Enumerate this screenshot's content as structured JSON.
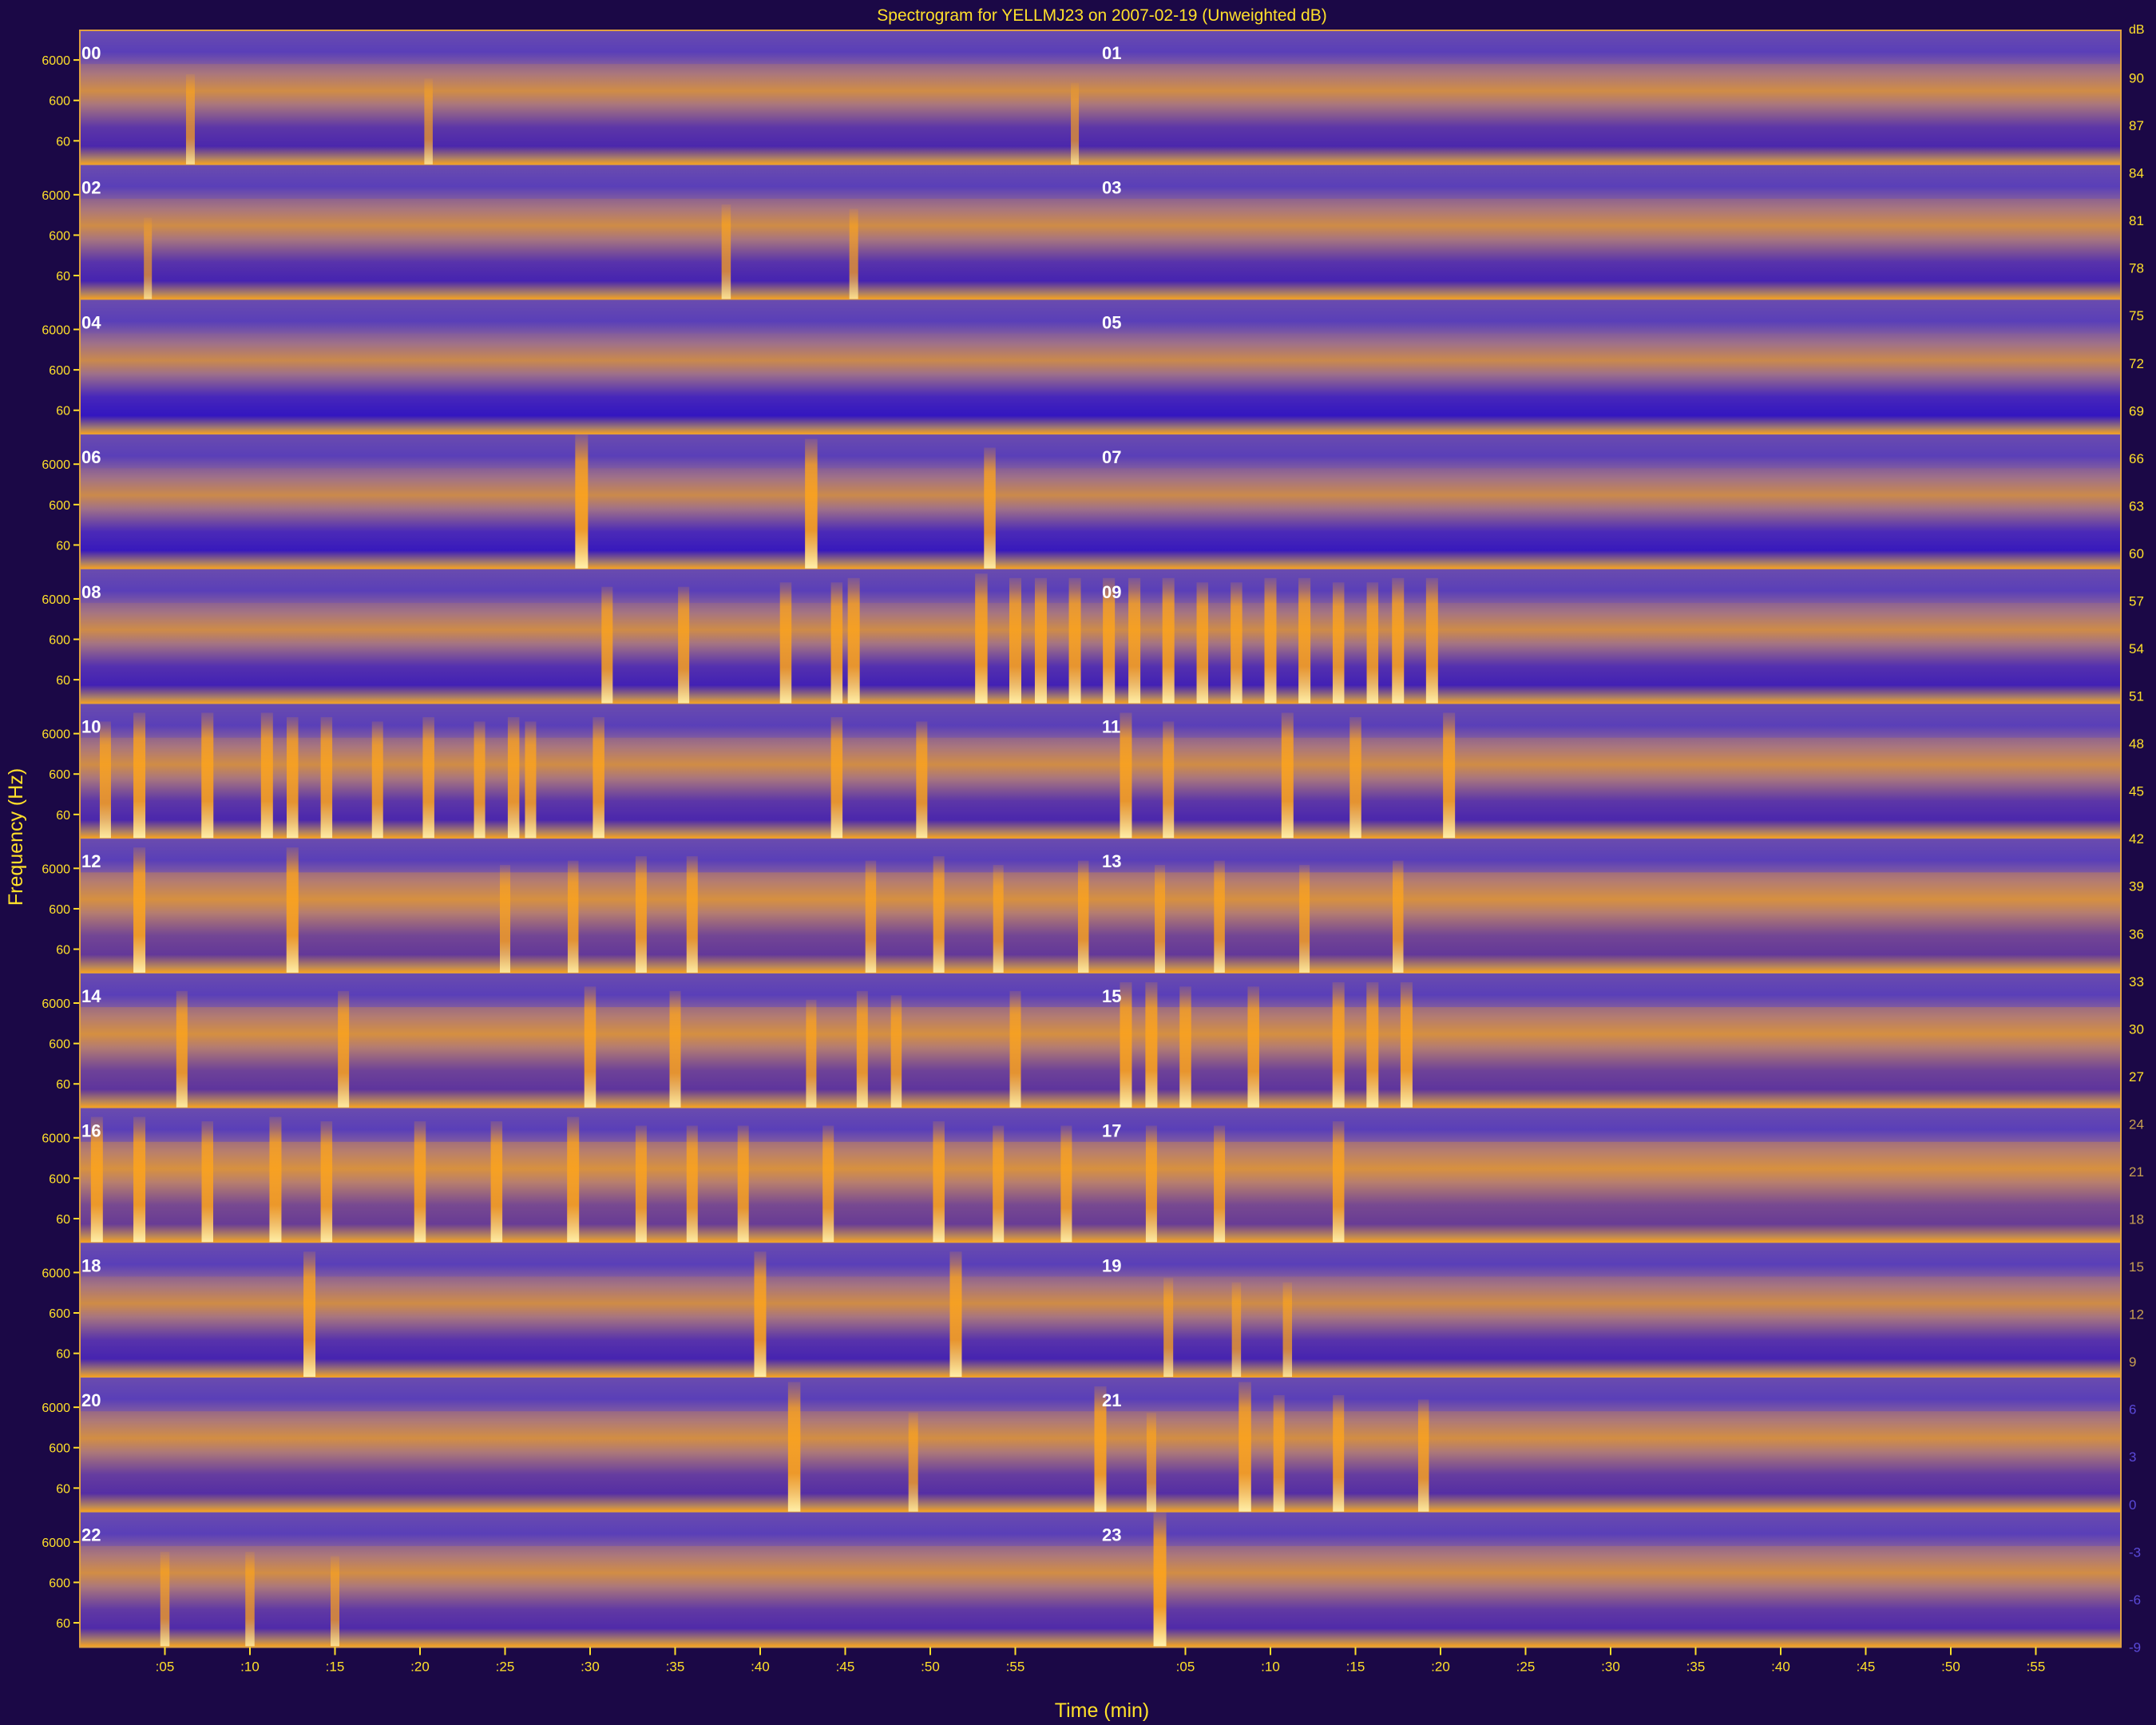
{
  "chart_data": {
    "type": "heatmap",
    "title": "Spectrogram for YELLMJ23 on 2007-02-19 (Unweighted dB)",
    "xlabel": "Time (min)",
    "ylabel": "Frequency (Hz)",
    "hour_labels": [
      "00",
      "01",
      "02",
      "03",
      "04",
      "05",
      "06",
      "07",
      "08",
      "09",
      "10",
      "11",
      "12",
      "13",
      "14",
      "15",
      "16",
      "17",
      "18",
      "19",
      "20",
      "21",
      "22",
      "23"
    ],
    "freq_ticks": [
      "6000",
      "600",
      "60"
    ],
    "minute_ticks": [
      ":05",
      ":10",
      ":15",
      ":20",
      ":25",
      ":30",
      ":35",
      ":40",
      ":45",
      ":50",
      ":55"
    ],
    "colorbar_unit": "dB",
    "colorbar_ticks": [
      "90",
      "87",
      "84",
      "81",
      "78",
      "75",
      "72",
      "69",
      "66",
      "63",
      "60",
      "57",
      "54",
      "51",
      "48",
      "45",
      "42",
      "39",
      "36",
      "33",
      "30",
      "27",
      "24",
      "21",
      "18",
      "15",
      "12",
      "9",
      "6",
      "3",
      "0",
      "-3",
      "-6",
      "-9"
    ],
    "colorbar_range": [
      -9,
      93
    ],
    "colormap": {
      "low": "#2a10c8",
      "mid": "#6a4cae",
      "high": "#ffa51a",
      "peak": "#fff2b0"
    },
    "rows": [
      {
        "hour_left": "00",
        "hour_right": "01",
        "activity": 0.35,
        "events": [
          [
            6.5,
            0.5
          ],
          [
            20.5,
            0.45
          ],
          [
            58.5,
            0.4
          ]
        ]
      },
      {
        "hour_left": "02",
        "hour_right": "03",
        "activity": 0.3,
        "events": [
          [
            38,
            0.55
          ],
          [
            45.5,
            0.5
          ],
          [
            4,
            0.4
          ]
        ]
      },
      {
        "hour_left": "04",
        "hour_right": "05",
        "activity": 0.1,
        "events": []
      },
      {
        "hour_left": "06",
        "hour_right": "07",
        "activity": 0.15,
        "events": [
          [
            29.5,
            1.0
          ],
          [
            43,
            0.95
          ],
          [
            53.5,
            0.85
          ]
        ]
      },
      {
        "hour_left": "08",
        "hour_right": "09",
        "activity": 0.25,
        "events": [
          [
            31,
            0.8
          ],
          [
            35.5,
            0.8
          ],
          [
            41.5,
            0.85
          ],
          [
            44.5,
            0.85
          ],
          [
            45.5,
            0.9
          ],
          [
            53,
            0.95
          ],
          [
            55,
            0.9
          ],
          [
            56.5,
            0.9
          ],
          [
            58.5,
            0.9
          ],
          [
            60.5,
            0.9
          ],
          [
            62,
            0.9
          ],
          [
            64,
            0.9
          ],
          [
            66,
            0.85
          ],
          [
            68,
            0.85
          ],
          [
            70,
            0.9
          ],
          [
            72,
            0.9
          ],
          [
            74,
            0.85
          ],
          [
            76,
            0.85
          ],
          [
            77.5,
            0.9
          ],
          [
            79.5,
            0.9
          ]
        ]
      },
      {
        "hour_left": "10",
        "hour_right": "11",
        "activity": 0.35,
        "events": [
          [
            1.5,
            0.8
          ],
          [
            3.5,
            0.9
          ],
          [
            7.5,
            0.9
          ],
          [
            11,
            0.9
          ],
          [
            12.5,
            0.85
          ],
          [
            14.5,
            0.85
          ],
          [
            17.5,
            0.8
          ],
          [
            20.5,
            0.85
          ],
          [
            23.5,
            0.8
          ],
          [
            25.5,
            0.85
          ],
          [
            26.5,
            0.8
          ],
          [
            30.5,
            0.85
          ],
          [
            44.5,
            0.85
          ],
          [
            49.5,
            0.8
          ],
          [
            61.5,
            0.9
          ],
          [
            64,
            0.8
          ],
          [
            71,
            0.9
          ],
          [
            75,
            0.85
          ],
          [
            80.5,
            0.9
          ]
        ]
      },
      {
        "hour_left": "12",
        "hour_right": "13",
        "activity": 0.6,
        "events": [
          [
            3.5,
            0.9
          ],
          [
            12.5,
            0.9
          ],
          [
            25,
            0.7
          ],
          [
            29,
            0.75
          ],
          [
            33,
            0.8
          ],
          [
            36,
            0.8
          ],
          [
            46.5,
            0.75
          ],
          [
            50.5,
            0.8
          ],
          [
            54,
            0.7
          ],
          [
            59,
            0.75
          ],
          [
            63.5,
            0.7
          ],
          [
            67,
            0.75
          ],
          [
            72,
            0.7
          ],
          [
            77.5,
            0.75
          ]
        ]
      },
      {
        "hour_left": "14",
        "hour_right": "15",
        "activity": 0.55,
        "events": [
          [
            6,
            0.8
          ],
          [
            15.5,
            0.8
          ],
          [
            30,
            0.85
          ],
          [
            35,
            0.8
          ],
          [
            43,
            0.7
          ],
          [
            46,
            0.8
          ],
          [
            48,
            0.75
          ],
          [
            55,
            0.8
          ],
          [
            61.5,
            0.9
          ],
          [
            63,
            0.9
          ],
          [
            65,
            0.85
          ],
          [
            69,
            0.85
          ],
          [
            74,
            0.9
          ],
          [
            76,
            0.9
          ],
          [
            78,
            0.9
          ]
        ]
      },
      {
        "hour_left": "16",
        "hour_right": "17",
        "activity": 0.65,
        "events": [
          [
            1,
            0.9
          ],
          [
            3.5,
            0.9
          ],
          [
            7.5,
            0.85
          ],
          [
            11.5,
            0.9
          ],
          [
            14.5,
            0.85
          ],
          [
            20,
            0.85
          ],
          [
            24.5,
            0.85
          ],
          [
            29,
            0.9
          ],
          [
            33,
            0.8
          ],
          [
            36,
            0.8
          ],
          [
            39,
            0.8
          ],
          [
            44,
            0.8
          ],
          [
            50.5,
            0.85
          ],
          [
            54,
            0.8
          ],
          [
            58,
            0.8
          ],
          [
            63,
            0.8
          ],
          [
            67,
            0.8
          ],
          [
            74,
            0.85
          ]
        ]
      },
      {
        "hour_left": "18",
        "hour_right": "19",
        "activity": 0.3,
        "events": [
          [
            13.5,
            0.9
          ],
          [
            40,
            0.9
          ],
          [
            51.5,
            0.9
          ],
          [
            64,
            0.6
          ],
          [
            68,
            0.55
          ],
          [
            71,
            0.55
          ]
        ]
      },
      {
        "hour_left": "20",
        "hour_right": "21",
        "activity": 0.45,
        "events": [
          [
            42,
            0.95
          ],
          [
            49,
            0.6
          ],
          [
            60,
            0.9
          ],
          [
            63,
            0.6
          ],
          [
            68.5,
            0.95
          ],
          [
            70.5,
            0.8
          ],
          [
            74,
            0.8
          ],
          [
            79,
            0.75
          ]
        ]
      },
      {
        "hour_left": "22",
        "hour_right": "23",
        "activity": 0.4,
        "events": [
          [
            5,
            0.55
          ],
          [
            10,
            0.55
          ],
          [
            15,
            0.5
          ],
          [
            63.5,
            1.0
          ]
        ]
      }
    ]
  }
}
